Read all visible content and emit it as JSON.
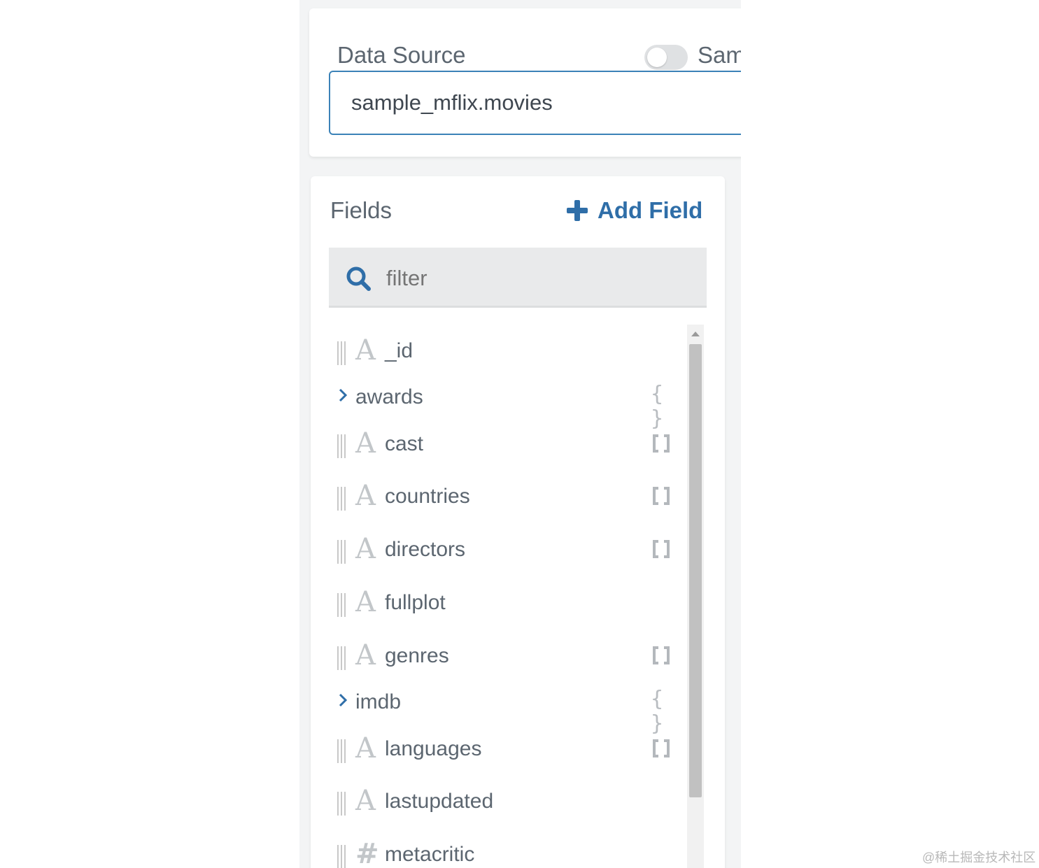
{
  "data_source": {
    "title": "Data Source",
    "sample_label": "Sam",
    "sample_enabled": false,
    "value": "sample_mflix.movies"
  },
  "fields_panel": {
    "title": "Fields",
    "add_field_label": "Add Field",
    "filter_placeholder": "filter",
    "fields": [
      {
        "name": "_id",
        "type": "string",
        "expandable": false,
        "bracket": ""
      },
      {
        "name": "awards",
        "type": "object",
        "expandable": true,
        "bracket": "object"
      },
      {
        "name": "cast",
        "type": "string",
        "expandable": false,
        "bracket": "array"
      },
      {
        "name": "countries",
        "type": "string",
        "expandable": false,
        "bracket": "array"
      },
      {
        "name": "directors",
        "type": "string",
        "expandable": false,
        "bracket": "array"
      },
      {
        "name": "fullplot",
        "type": "string",
        "expandable": false,
        "bracket": ""
      },
      {
        "name": "genres",
        "type": "string",
        "expandable": false,
        "bracket": "array"
      },
      {
        "name": "imdb",
        "type": "object",
        "expandable": true,
        "bracket": "object"
      },
      {
        "name": "languages",
        "type": "string",
        "expandable": false,
        "bracket": "array"
      },
      {
        "name": "lastupdated",
        "type": "string",
        "expandable": false,
        "bracket": ""
      },
      {
        "name": "metacritic",
        "type": "number",
        "expandable": false,
        "bracket": ""
      }
    ]
  },
  "watermark": "@稀土掘金技术社区",
  "colors": {
    "accent": "#2f6ea8",
    "input_border": "#3b82b7",
    "text": "#5c6670",
    "icon_muted": "#c2c6c9"
  }
}
